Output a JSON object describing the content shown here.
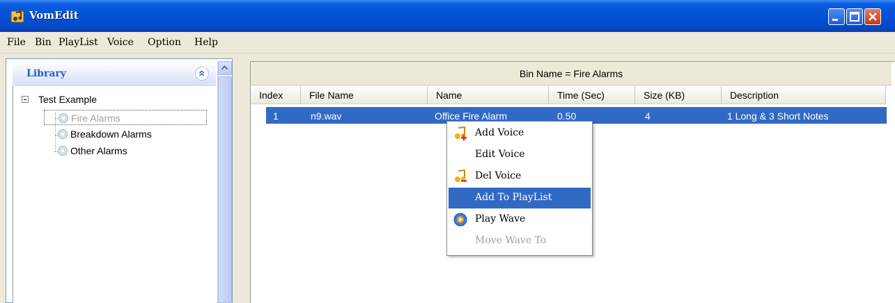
{
  "window": {
    "title": "VomEdit",
    "colors": {
      "titlebar": "#0551d6",
      "selection": "#316ac5",
      "accent": "#215dc6"
    }
  },
  "menu": [
    {
      "label": "File"
    },
    {
      "label": "Bin"
    },
    {
      "label": "PlayList"
    },
    {
      "label": "Voice"
    },
    {
      "label": "Option"
    },
    {
      "label": "Help"
    }
  ],
  "library": {
    "title": "Library",
    "tree": {
      "root": "Test Example",
      "children": [
        "Fire Alarms",
        "Breakdown Alarms",
        "Other Alarms"
      ],
      "selected": "Fire Alarms"
    }
  },
  "bin": {
    "header": "Bin Name = Fire Alarms",
    "columns": [
      "Index",
      "File Name",
      "Name",
      "Time (Sec)",
      "Size (KB)",
      "Description"
    ],
    "rows": [
      [
        "1",
        "n9.wav",
        "Office Fire Alarm",
        "0.50",
        "4",
        "1 Long & 3 Short Notes"
      ]
    ]
  },
  "context_menu": {
    "items": [
      {
        "label": "Add  Voice",
        "icon": "add-voice-icon",
        "state": "normal"
      },
      {
        "label": "Edit  Voice",
        "icon": "",
        "state": "normal"
      },
      {
        "label": "Del Voice",
        "icon": "del-voice-icon",
        "state": "normal"
      },
      {
        "label": "Add  To  PlayList",
        "icon": "",
        "state": "highlighted"
      },
      {
        "label": "Play  Wave",
        "icon": "play-wave-icon",
        "state": "normal"
      },
      {
        "label": "Move  Wave  To",
        "icon": "",
        "state": "disabled"
      }
    ]
  }
}
